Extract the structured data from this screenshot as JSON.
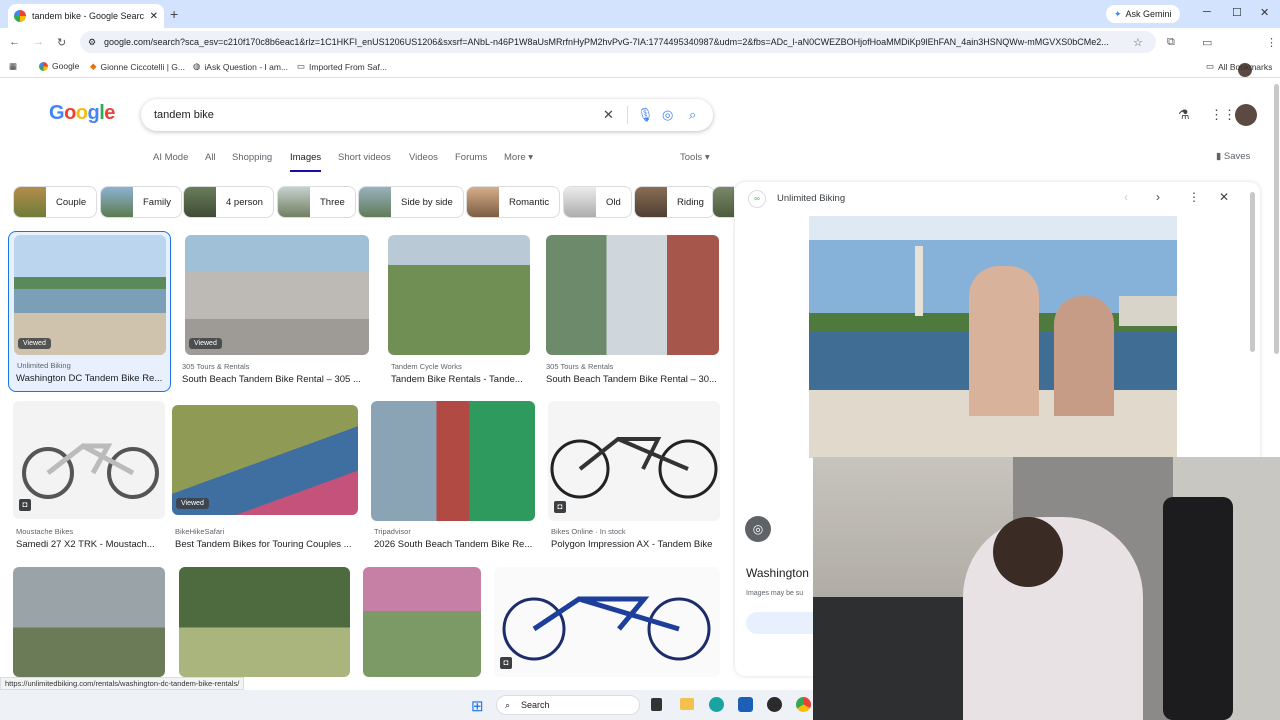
{
  "browser": {
    "tab_title": "tandem bike - Google Search",
    "ask_label": "Ask Gemini",
    "url": "google.com/search?sca_esv=c210f170c8b6eac1&rlz=1C1HKFI_enUS1206US1206&sxsrf=ANbL-n46P1W8aUsMRrfnHyPM2hvPvG-7IA:1774495340987&udm=2&fbs=ADc_l-aN0CWEZBOHjofHoaMMDiKp9lEhFAN_4ain3HSNQWw-mMGVXS0bCMe2...",
    "status_url": "https://unlimitedbiking.com/rentals/washington-dc-tandem-bike-rentals/"
  },
  "bookmarks": {
    "items": [
      "Google",
      "Gionne Ciccotelli | G...",
      "iAsk Question - I am...",
      "Imported From Saf..."
    ],
    "all_label": "All Bookmarks"
  },
  "google": {
    "logo": "Google",
    "query": "tandem bike",
    "tabs": [
      "AI Mode",
      "All",
      "Shopping",
      "Images",
      "Short videos",
      "Videos",
      "Forums",
      "More"
    ],
    "tools_label": "Tools",
    "saves_label": "Saves"
  },
  "chips": [
    "Couple",
    "Family",
    "4 person",
    "Three",
    "Side by side",
    "Romantic",
    "Old",
    "Riding"
  ],
  "results": [
    {
      "source": "Unlimited Biking",
      "title": "Washington DC Tandem Bike Re...",
      "badge": "Viewed"
    },
    {
      "source": "305 Tours & Rentals",
      "title": "South Beach Tandem Bike Rental – 305 ...",
      "badge": "Viewed"
    },
    {
      "source": "Tandem Cycle Works",
      "title": "Tandem Bike Rentals - Tande...",
      "badge": ""
    },
    {
      "source": "305 Tours & Rentals",
      "title": "South Beach Tandem Bike Rental – 30...",
      "badge": ""
    },
    {
      "source": "Moustache Bikes",
      "title": "Samedi 27 X2 TRK - Moustach...",
      "badge": ""
    },
    {
      "source": "BikeHikeSafari",
      "title": "Best Tandem Bikes for Touring Couples ...",
      "badge": "Viewed"
    },
    {
      "source": "Tripadvisor",
      "title": "2026 South Beach Tandem Bike Re...",
      "badge": ""
    },
    {
      "source": "Bikes Online · In stock",
      "title": "Polygon Impression AX - Tandem Bike",
      "badge": ""
    }
  ],
  "panel": {
    "source": "Unlimited Biking",
    "title_partial": "Washington",
    "note_partial": "Images may be su"
  },
  "taskbar": {
    "search_label": "Search"
  }
}
